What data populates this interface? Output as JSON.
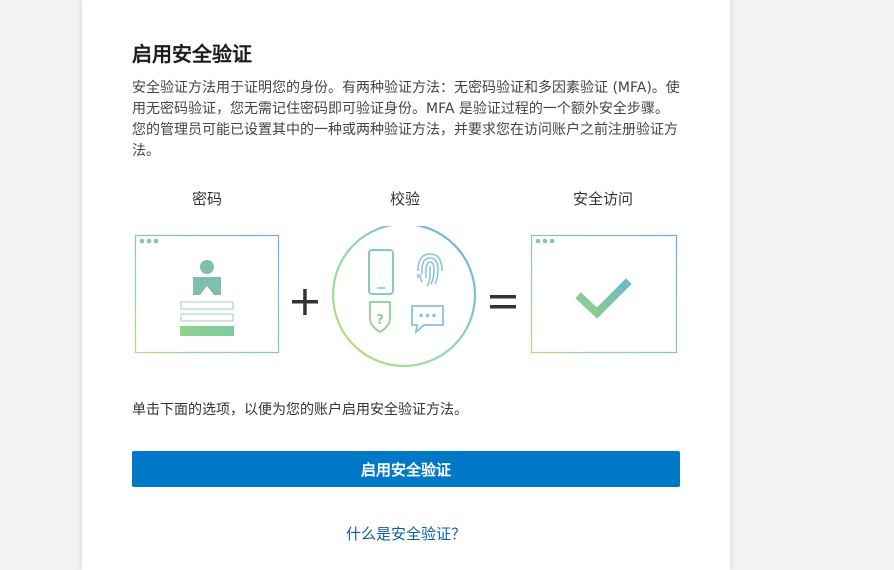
{
  "card": {
    "title": "启用安全验证",
    "description": "安全验证方法用于证明您的身份。有两种验证方法：无密码验证和多因素验证 (MFA)。使用无密码验证，您无需记住密码即可验证身份。MFA 是验证过程的一个额外安全步骤。您的管理员可能已设置其中的一种或两种验证方法，并要求您在访问账户之前注册验证方法。",
    "steps": [
      {
        "label": "密码"
      },
      {
        "label": "校验"
      },
      {
        "label": "安全访问"
      }
    ],
    "instruction": "单击下面的选项，以便为您的账户启用安全验证方法。",
    "primary_button": "启用安全验证",
    "help_link": "什么是安全验证？"
  },
  "colors": {
    "accent": "#0078c8",
    "link": "#0f5fa8",
    "green": "#7fcf97",
    "teal": "#6cb7c9",
    "blue": "#72aee6"
  },
  "icons": [
    "browser-window-icon",
    "user-icon",
    "plus-icon",
    "phone-icon",
    "fingerprint-icon",
    "shield-question-icon",
    "chat-bubble-icon",
    "equals-icon",
    "checkmark-icon"
  ]
}
